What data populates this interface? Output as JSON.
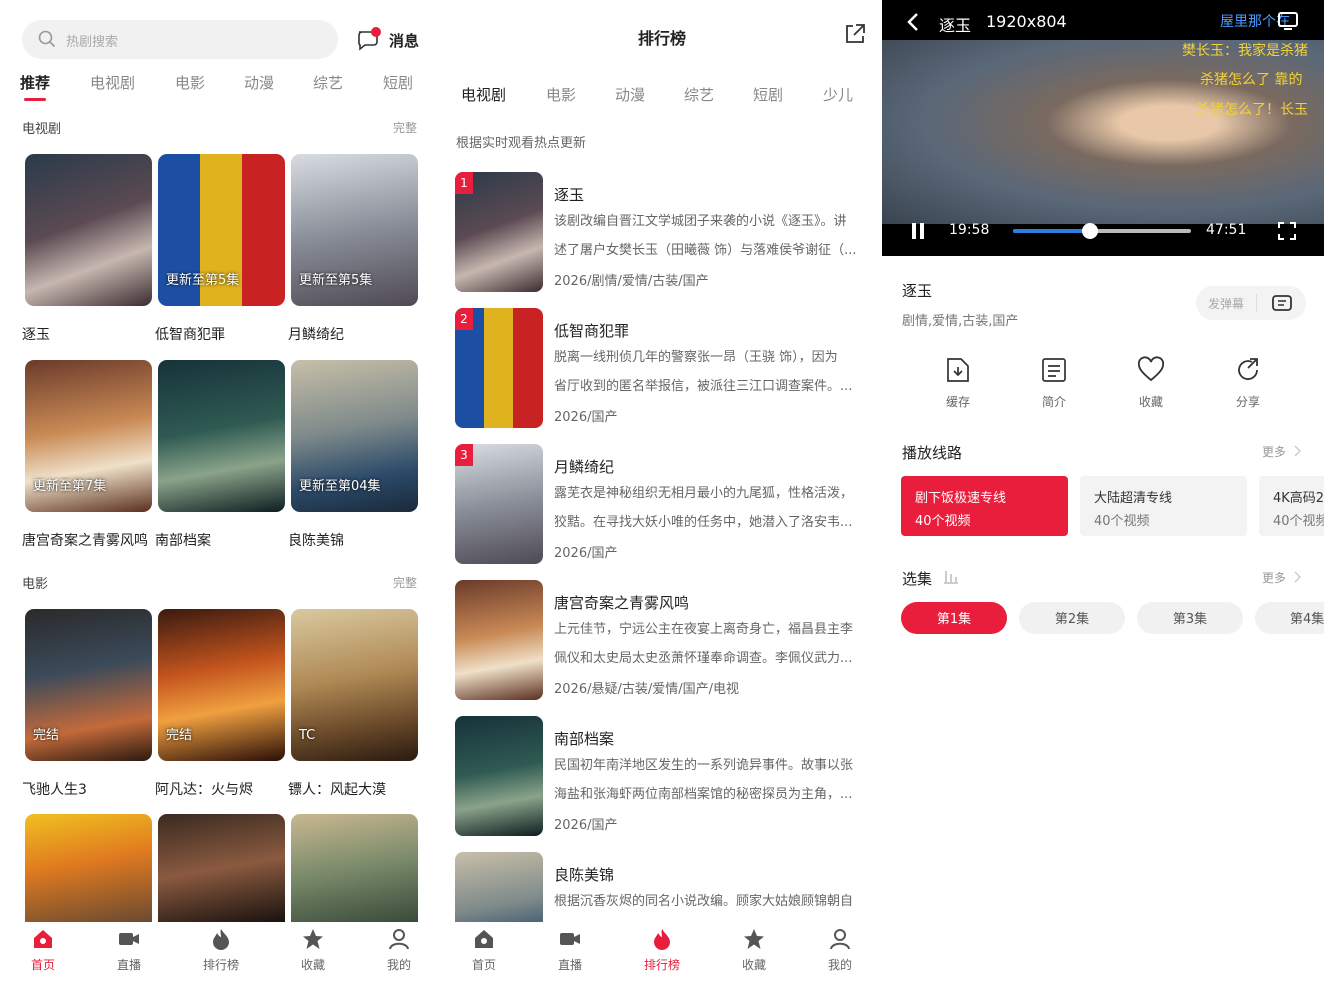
{
  "home": {
    "search_placeholder": "热剧搜索",
    "messages_label": "消息",
    "tabs": [
      "推荐",
      "电视剧",
      "电影",
      "动漫",
      "综艺",
      "短剧"
    ],
    "tv_section": {
      "title": "电视剧",
      "more": "完整"
    },
    "tv_items": [
      {
        "title": "逐玉",
        "badge": ""
      },
      {
        "title": "低智商犯罪",
        "badge": "更新至第5集"
      },
      {
        "title": "月鳞绮纪",
        "badge": "更新至第5集"
      },
      {
        "title": "唐宫奇案之青雾风鸣",
        "badge": "更新至第7集"
      },
      {
        "title": "南部档案",
        "badge": ""
      },
      {
        "title": "良陈美锦",
        "badge": "更新至第04集"
      }
    ],
    "movie_section": {
      "title": "电影",
      "more": "完整"
    },
    "movie_items": [
      {
        "title": "飞驰人生3",
        "badge": "完结"
      },
      {
        "title": "阿凡达：火与烬",
        "badge": "完结"
      },
      {
        "title": "镖人：风起大漠",
        "badge": "TC"
      }
    ],
    "nav": [
      "首页",
      "直播",
      "排行榜",
      "收藏",
      "我的"
    ]
  },
  "rank": {
    "title": "排行榜",
    "tabs": [
      "电视剧",
      "电影",
      "动漫",
      "综艺",
      "短剧",
      "少儿"
    ],
    "subtitle": "根据实时观看热点更新",
    "items": [
      {
        "rank": "1",
        "title": "逐玉",
        "desc1": "该剧改编自晋江文学城团子来袭的小说《逐玉》。讲",
        "desc2": "述了屠户女樊长玉（田曦薇 饰）与落难侯爷谢征（...",
        "meta": "2026/剧情/爱情/古装/国产"
      },
      {
        "rank": "2",
        "title": "低智商犯罪",
        "desc1": "脱离一线刑侦几年的警察张一昂（王骁 饰），因为",
        "desc2": "省厅收到的匿名举报信，被派往三江口调查案件。...",
        "meta": "2026/国产"
      },
      {
        "rank": "3",
        "title": "月鳞绮纪",
        "desc1": "露芜衣是神秘组织无相月最小的九尾狐，性格活泼，",
        "desc2": "狡黠。在寻找大妖小唯的任务中，她潜入了洛安韦...",
        "meta": "2026/国产"
      },
      {
        "rank": "",
        "title": "唐宫奇案之青雾风鸣",
        "desc1": "上元佳节，宁远公主在夜宴上离奇身亡，福昌县主李",
        "desc2": "佩仪和太史局太史丞萧怀瑾奉命调查。李佩仪武力...",
        "meta": "2026/悬疑/古装/爱情/国产/电视"
      },
      {
        "rank": "",
        "title": "南部档案",
        "desc1": "民国初年南洋地区发生的一系列诡异事件。故事以张",
        "desc2": "海盐和张海虾两位南部档案馆的秘密探员为主角，...",
        "meta": "2026/国产"
      },
      {
        "rank": "",
        "title": "良陈美锦",
        "desc1": "根据沉香灰烬的同名小说改编。顾家大姑娘顾锦朝自",
        "desc2": "",
        "meta": ""
      }
    ],
    "nav": [
      "首页",
      "直播",
      "排行榜",
      "收藏",
      "我的"
    ]
  },
  "player": {
    "title": "逐玉",
    "resolution": "1920x804",
    "danmaku": [
      "屋里那个在",
      "樊长玉：我家是杀猪",
      "杀猪怎么了 靠的",
      "杀猪怎么了！长玉"
    ],
    "time_current": "19:58",
    "time_total": "47:51",
    "progress": 0.43,
    "show_title": "逐玉",
    "show_tags": "剧情,爱情,古装,国产",
    "danmaku_button": "发弹幕",
    "actions": [
      "缓存",
      "简介",
      "收藏",
      "分享"
    ],
    "lines_title": "播放线路",
    "lines_more": "更多",
    "lines": [
      {
        "name": "剧下饭极速专线",
        "count": "40个视频"
      },
      {
        "name": "大陆超清专线",
        "count": "40个视频"
      },
      {
        "name": "4K高码2",
        "count": "40个视频"
      }
    ],
    "episodes_title": "选集",
    "episodes_more": "更多",
    "episodes": [
      "第1集",
      "第2集",
      "第3集",
      "第4集"
    ],
    "accent": "#e91e3c"
  }
}
